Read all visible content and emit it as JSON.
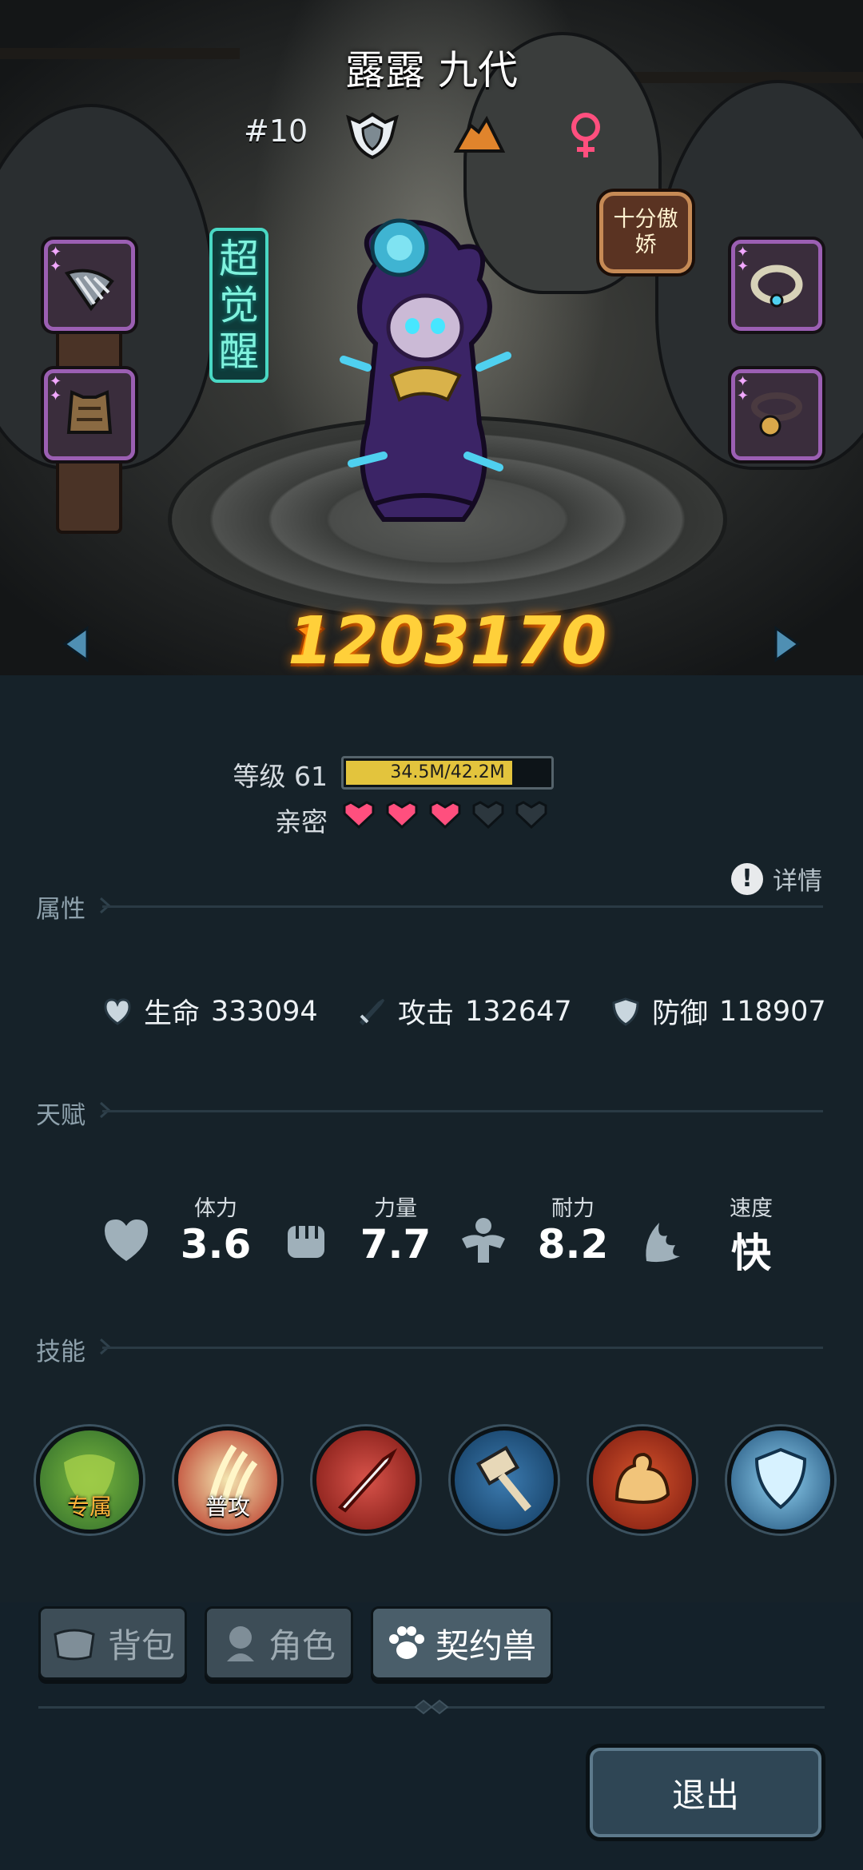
{
  "hero": {
    "name": "露露 九代",
    "rank": "#10",
    "awaken_tag": "超觉醒",
    "personality_badge": "十分傲娇",
    "power": "1203170",
    "icons": [
      "shield-badge-icon",
      "terrain-icon",
      "female-icon"
    ],
    "equipment": [
      "claw-weapon",
      "armor-vest",
      "necklace",
      "bell-collar"
    ]
  },
  "level": {
    "label": "等级 61",
    "exp_text": "34.5M/42.2M",
    "exp_progress": 0.82
  },
  "intimacy": {
    "label": "亲密",
    "filled": 3,
    "total": 5
  },
  "sections": {
    "attributes": "属性",
    "talent": "天赋",
    "skills": "技能",
    "detail": "详情"
  },
  "stats": [
    {
      "name": "生命",
      "value": "333094",
      "icon": "heart-shield-icon"
    },
    {
      "name": "攻击",
      "value": "132647",
      "icon": "sword-icon"
    },
    {
      "name": "防御",
      "value": "118907",
      "icon": "shield-icon"
    }
  ],
  "talents": [
    {
      "name": "体力",
      "value": "3.6",
      "icon": "heart-icon"
    },
    {
      "name": "力量",
      "value": "7.7",
      "icon": "fist-icon"
    },
    {
      "name": "耐力",
      "value": "8.2",
      "icon": "muscle-icon"
    },
    {
      "name": "速度",
      "value": "快",
      "icon": "wing-icon"
    }
  ],
  "skills": [
    {
      "caption": "专属",
      "icon": "nature-skill-icon"
    },
    {
      "caption": "普攻",
      "icon": "claw-skill-icon"
    },
    {
      "caption": "",
      "icon": "blade-skill-icon"
    },
    {
      "caption": "",
      "icon": "hammer-skill-icon"
    },
    {
      "caption": "",
      "icon": "strength-skill-icon"
    },
    {
      "caption": "",
      "icon": "ice-shield-skill-icon"
    }
  ],
  "tabs": [
    {
      "label": "背包",
      "icon": "bag-icon",
      "active": false
    },
    {
      "label": "角色",
      "icon": "character-icon",
      "active": false
    },
    {
      "label": "契约兽",
      "icon": "paw-icon",
      "active": true
    }
  ],
  "exit_label": "退出",
  "colors": {
    "power": "#ffd03a",
    "exp_bar": "#e3c43d",
    "heart_filled": "#ff4f7e",
    "awaken": "#49d8c4",
    "equip_border": "#9b5fb3"
  }
}
